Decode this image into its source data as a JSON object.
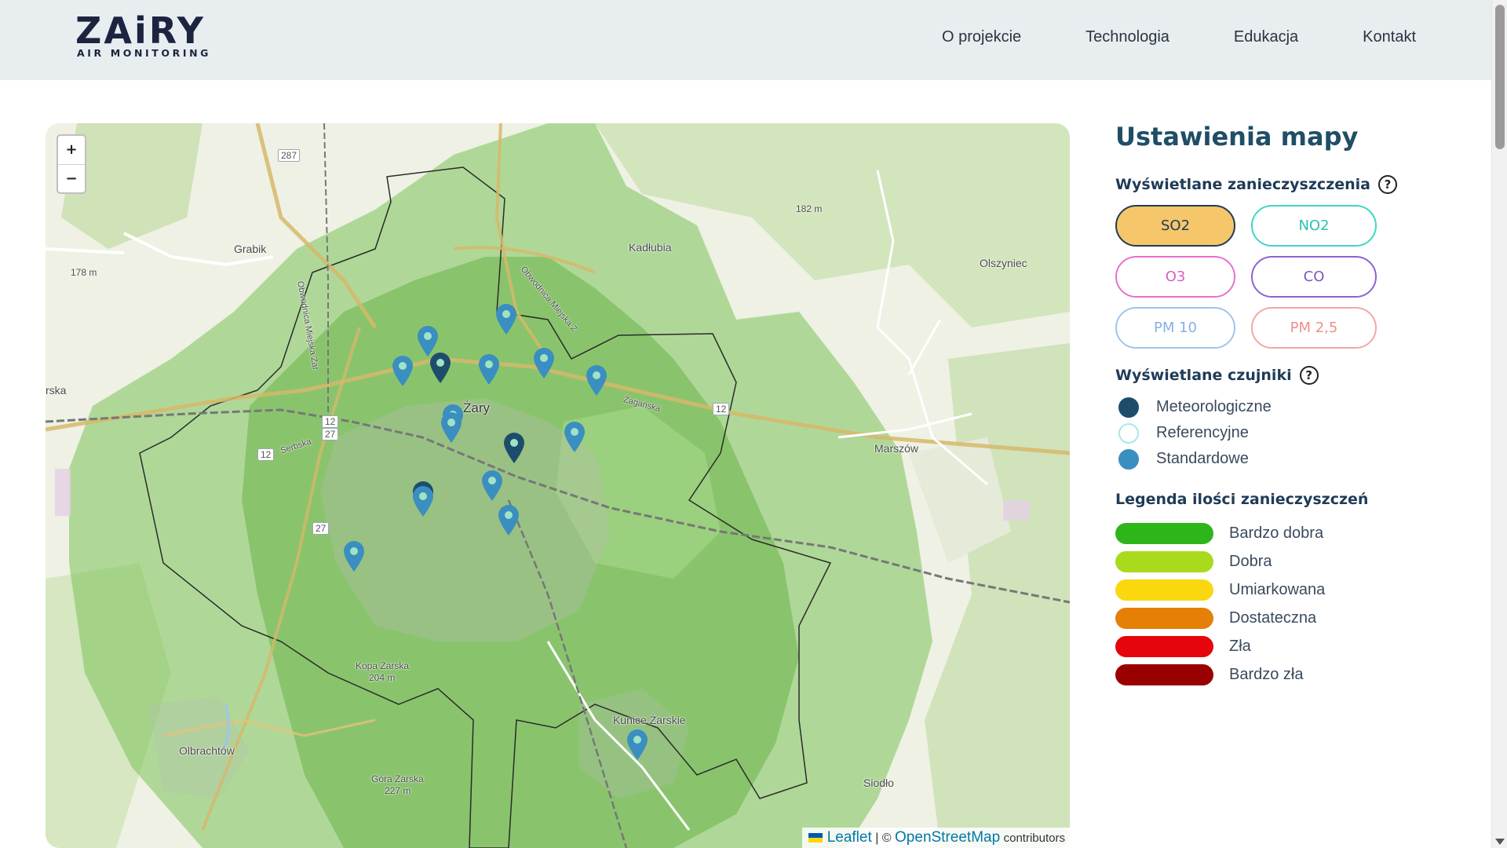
{
  "header": {
    "logo_main": "ZAiRY",
    "logo_sub": "AIR MONITORING",
    "nav": [
      "O projekcie",
      "Technologia",
      "Edukacja",
      "Kontakt"
    ]
  },
  "map": {
    "zoom_in": "+",
    "zoom_out": "−",
    "attribution": {
      "leaflet": "Leaflet",
      "separator": "| ©",
      "osm": "OpenStreetMap",
      "contributors": "contributors"
    },
    "labels": {
      "zary": "Żary",
      "grabik": "Grabik",
      "kadlubia": "Kadłubia",
      "olszyniec": "Olszyniec",
      "marszow": "Marszów",
      "olbrachtow": "Olbrachtów",
      "kunice": "Kunice Żarskie",
      "siodlo": "Siodło",
      "kopa": "Kopa Żarska",
      "kopa_h": "204 m",
      "gora": "Góra Żarska",
      "gora_h": "227 m",
      "h182": "182 m",
      "h178": "178 m",
      "rska": "rska",
      "obw1": "Obwodnica Miejska Żar",
      "obw2": "Obwodnica Miejska Ż",
      "zaganska": "Żagańska",
      "serbska": "Serbska"
    },
    "shields": {
      "r287": "287",
      "r12a": "12",
      "r12b": "12",
      "r12c": "12",
      "r27a": "27",
      "r27b": "27",
      "r12_27a": "12",
      "r12_27b": "27"
    }
  },
  "panel": {
    "title": "Ustawienia mapy",
    "pollutants_title": "Wyświetlane zanieczyszczenia",
    "help_symbol": "?",
    "pollutants": [
      {
        "label": "SO2",
        "active": true,
        "border": "#1f3b57",
        "bg": "#f6c66a",
        "color": "#1f3b57"
      },
      {
        "label": "NO2",
        "active": false,
        "border": "#3fd6c4",
        "bg": "#ffffff",
        "color": "#2bc2b0"
      },
      {
        "label": "O3",
        "active": false,
        "border": "#e96fd0",
        "bg": "#ffffff",
        "color": "#d85fc0"
      },
      {
        "label": "CO",
        "active": false,
        "border": "#8a63d2",
        "bg": "#ffffff",
        "color": "#7a55c6"
      },
      {
        "label": "PM 10",
        "active": false,
        "border": "#9ec4f0",
        "bg": "#ffffff",
        "color": "#86b0e6"
      },
      {
        "label": "PM 2,5",
        "active": false,
        "border": "#f3a7a3",
        "bg": "#ffffff",
        "color": "#ee8f8a"
      }
    ],
    "sensors_title": "Wyświetlane czujniki",
    "sensors": [
      {
        "label": "Meteorologiczne",
        "color": "#1e4d6b",
        "border": "#1e4d6b"
      },
      {
        "label": "Referencyjne",
        "color": "#ffffff",
        "border": "#a8e6f0"
      },
      {
        "label": "Standardowe",
        "color": "#3a8fc0",
        "border": "#3a8fc0"
      }
    ],
    "legend_title": "Legenda ilości zanieczyszczeń",
    "legend": [
      {
        "label": "Bardzo dobra",
        "color": "#2eb51a"
      },
      {
        "label": "Dobra",
        "color": "#a9db1c"
      },
      {
        "label": "Umiarkowana",
        "color": "#fbd70f"
      },
      {
        "label": "Dostateczna",
        "color": "#e57f06"
      },
      {
        "label": "Zła",
        "color": "#e5050a"
      },
      {
        "label": "Bardzo zła",
        "color": "#990000"
      }
    ]
  }
}
